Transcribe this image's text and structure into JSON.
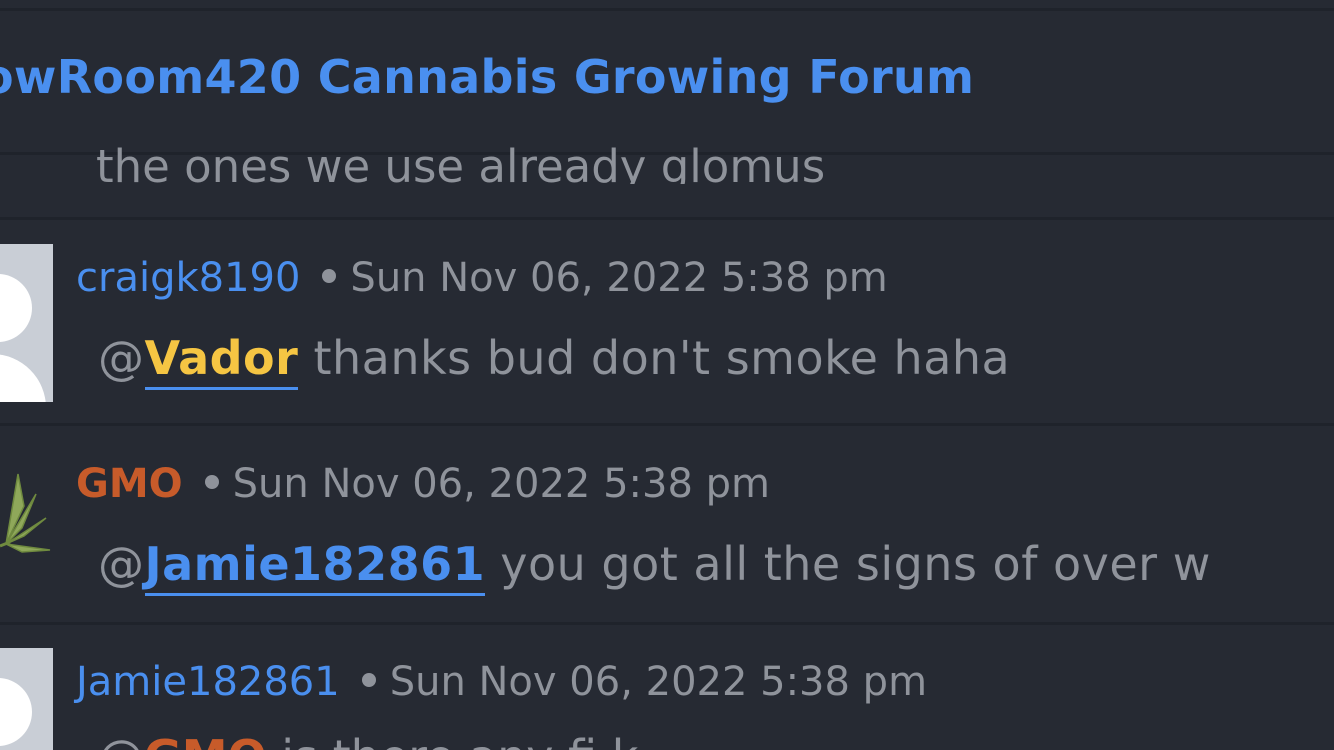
{
  "header": {
    "title": "owRoom420 Cannabis Growing Forum"
  },
  "previous_post": {
    "text_fragment": "the ones we use already glomus"
  },
  "posts": [
    {
      "username": "craigk8190",
      "timestamp": "Sun Nov 06, 2022 5:38 pm",
      "at_sign": "@",
      "mention": "Vador",
      "mention_color": "#f5c543",
      "text": " thanks bud don't smoke haha"
    },
    {
      "username": "GMO",
      "username_color": "#c75b2a",
      "timestamp": "Sun Nov 06, 2022 5:38 pm",
      "at_sign": "@",
      "mention": "Jamie182861",
      "mention_color": "#4a8fef",
      "text": " you got all the signs of over w"
    },
    {
      "username": "Jamie182861",
      "timestamp": "Sun Nov 06, 2022 5:38 pm",
      "at_sign": "@",
      "mention": "GMO",
      "mention_color": "#c75b2a",
      "text": " is there any fi  k"
    }
  ],
  "colors": {
    "background": "#262a33",
    "divider": "#1f232b",
    "link": "#4a8fef",
    "muted_text": "#8f939b"
  },
  "icons": {
    "default_avatar": "default-avatar-icon",
    "leaf_avatar": "cannabis-leaf-icon",
    "separator": "bullet-dot-icon"
  }
}
